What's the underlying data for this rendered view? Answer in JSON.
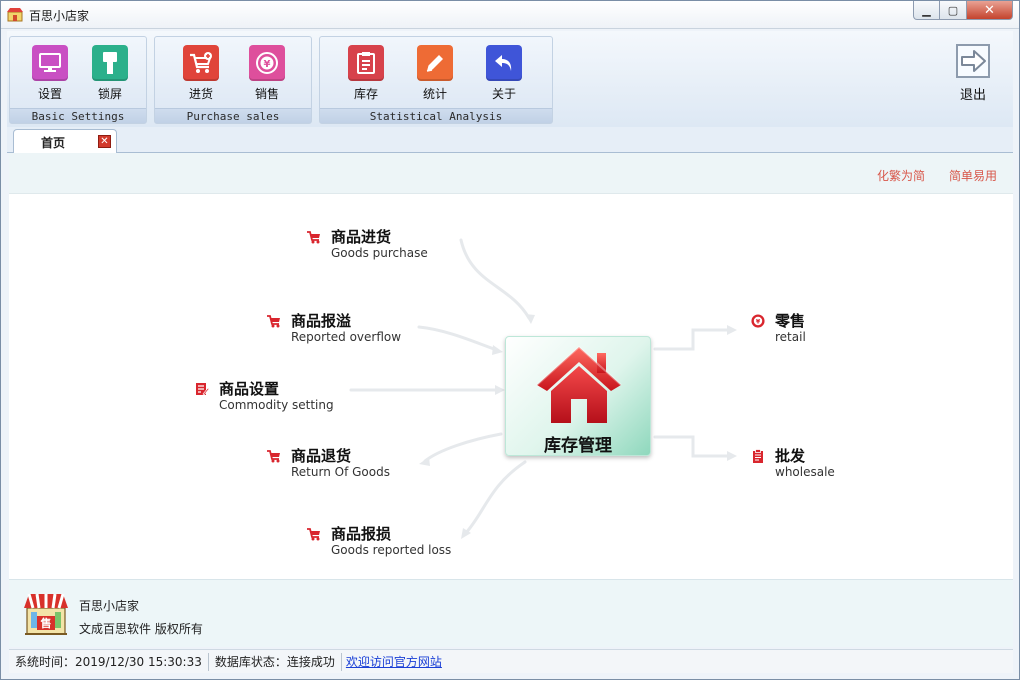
{
  "window": {
    "title": "百思小店家"
  },
  "ribbon": {
    "groups": [
      {
        "label": "Basic Settings",
        "buttons": [
          {
            "label": "设置",
            "icon": "monitor-icon",
            "color": "#c94fc3"
          },
          {
            "label": "锁屏",
            "icon": "lock-icon",
            "color": "#2bb08b"
          }
        ]
      },
      {
        "label": "Purchase sales",
        "buttons": [
          {
            "label": "进货",
            "icon": "cart-plus-icon",
            "color": "#e0443a"
          },
          {
            "label": "销售",
            "icon": "yen-coin-icon",
            "color": "#de4f9c"
          }
        ]
      },
      {
        "label": "Statistical Analysis",
        "buttons": [
          {
            "label": "库存",
            "icon": "clipboard-icon",
            "color": "#d7424b"
          },
          {
            "label": "统计",
            "icon": "pencil-icon",
            "color": "#ee6b35"
          },
          {
            "label": "关于",
            "icon": "undo-arrow-icon",
            "color": "#3f55d8"
          }
        ]
      }
    ],
    "exit": {
      "label": "退出",
      "icon": "exit-arrow-icon"
    }
  },
  "tabs": [
    {
      "label": "首页"
    }
  ],
  "toolbar": {
    "simplify_label": "化繁为简",
    "easy_label": "简单易用"
  },
  "diagram": {
    "hub": {
      "label": "库存管理",
      "icon": "house-icon"
    },
    "nodes": {
      "purchase": {
        "title": "商品进货",
        "sub": "Goods purchase",
        "icon": "cart-icon"
      },
      "overflow": {
        "title": "商品报溢",
        "sub": "Reported overflow",
        "icon": "cart-icon"
      },
      "setting": {
        "title": "商品设置",
        "sub": "Commodity setting",
        "icon": "edit-doc-icon"
      },
      "return": {
        "title": "商品退货",
        "sub": "Return Of Goods",
        "icon": "cart-icon"
      },
      "loss": {
        "title": "商品报损",
        "sub": "Goods reported loss",
        "icon": "cart-icon"
      },
      "retail": {
        "title": "零售",
        "sub": "retail",
        "icon": "yen-coin-icon"
      },
      "wholesale": {
        "title": "批发",
        "sub": "wholesale",
        "icon": "clipboard-icon"
      }
    },
    "icon_color": "#d9262e"
  },
  "footer": {
    "name": "百思小店家",
    "copyright": "文成百思软件  版权所有",
    "logo_text": "售"
  },
  "status": {
    "time": "系统时间：2019/12/30 15:30:33",
    "db": "数据库状态：连接成功",
    "link": "欢迎访问官方网站"
  }
}
